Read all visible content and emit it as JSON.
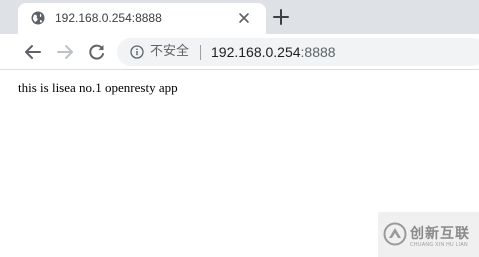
{
  "tab": {
    "title": "192.168.0.254:8888"
  },
  "toolbar": {
    "security_label": "不安全",
    "url_host": "192.168.0.254",
    "url_port": ":8888"
  },
  "page": {
    "text": "this is lisea no.1 openresty app"
  },
  "watermark": {
    "brand": "创新互联",
    "sub": "CHUANG XIN HU LIAN"
  },
  "icons": {
    "tab_favicon": "globe-icon",
    "tab_close": "close-icon",
    "new_tab": "plus-icon",
    "back": "arrow-left-icon",
    "forward": "arrow-right-icon",
    "reload": "reload-icon",
    "site_info": "info-icon"
  },
  "colors": {
    "tabstrip_bg": "#dee1e6",
    "omnibox_bg": "#f1f3f4"
  }
}
